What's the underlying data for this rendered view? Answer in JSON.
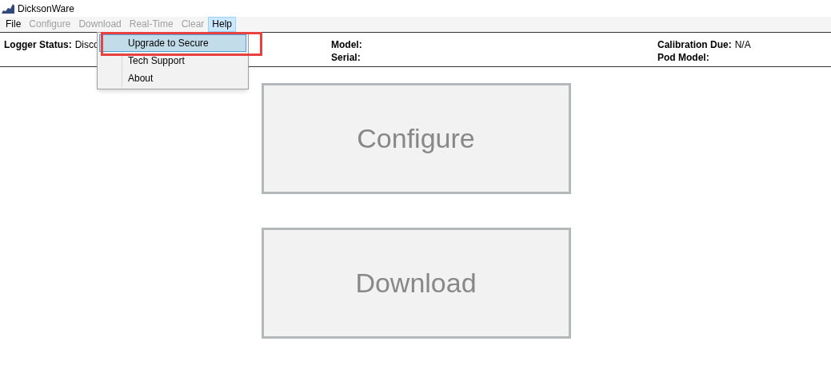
{
  "window": {
    "title": "DicksonWare"
  },
  "menu": [
    {
      "label": "File",
      "disabled": false,
      "selected": false
    },
    {
      "label": "Configure",
      "disabled": true,
      "selected": false
    },
    {
      "label": "Download",
      "disabled": true,
      "selected": false
    },
    {
      "label": "Real-Time",
      "disabled": true,
      "selected": false
    },
    {
      "label": "Clear",
      "disabled": true,
      "selected": false
    },
    {
      "label": "Help",
      "disabled": false,
      "selected": true
    }
  ],
  "help_menu": [
    {
      "label": "Upgrade to Secure",
      "selected": true,
      "highlighted": true
    },
    {
      "label": "Tech Support",
      "selected": false,
      "highlighted": false
    },
    {
      "label": "About",
      "selected": false,
      "highlighted": false
    }
  ],
  "status": [
    {
      "label": "Logger Status:",
      "value": "Disco"
    },
    {
      "label": "Model:"
    },
    {
      "label": "Serial:"
    },
    {
      "label": "Calibration Due:",
      "value": "N/A"
    },
    {
      "label": "Pod Model:"
    }
  ],
  "actions": [
    "Configure",
    "Download"
  ]
}
